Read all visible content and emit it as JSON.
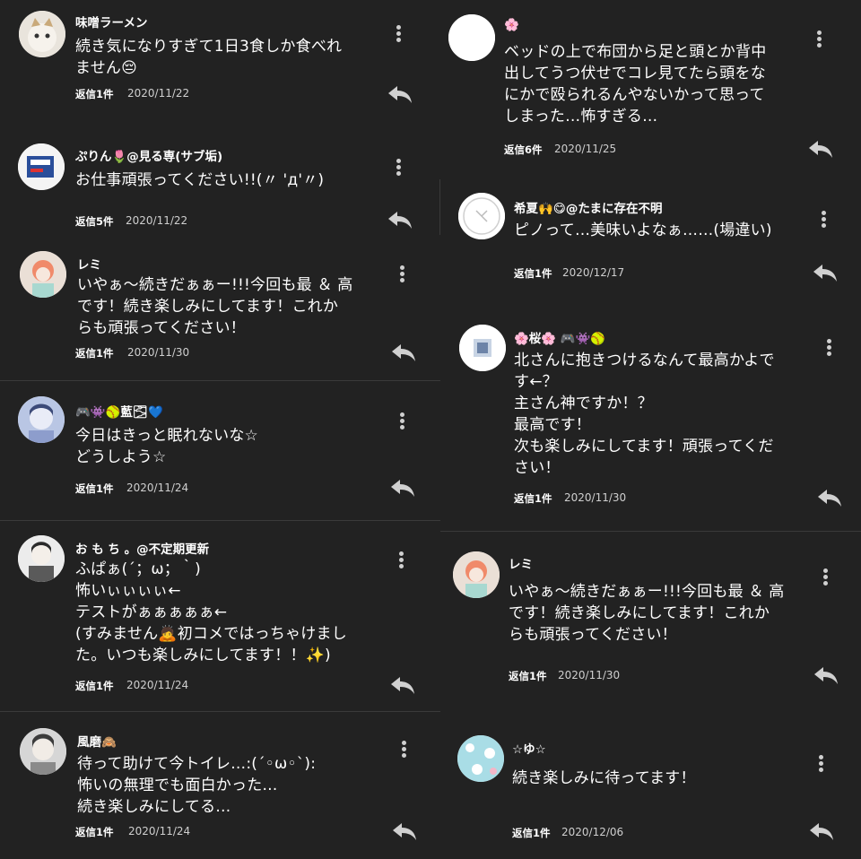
{
  "colors": {
    "background": "#222222",
    "text": "#ffffff",
    "date": "#cfcfcf",
    "icon": "#d0d0d0",
    "divider": "#3a3a3a"
  },
  "icons": {
    "more": "vertical-ellipsis-icon",
    "reply": "reply-arrow-icon"
  },
  "left_comments": [
    {
      "name": "味噌ラーメン",
      "body": "続き気になりすぎて1日3食しか食べれ\nません😔",
      "reply_label": "返信1件",
      "date": "2020/11/22"
    },
    {
      "name": "ぷりん🌷@見る専(サブ垢)",
      "body": "お仕事頑張ってください!!(〃 'д'〃)",
      "reply_label": "返信5件",
      "date": "2020/11/22"
    },
    {
      "name": "レミ",
      "body": "いやぁ〜続きだぁぁー!!!今回も最 ＆ 高\nです！続き楽しみにしてます！これか\nらも頑張ってください！",
      "reply_label": "返信1件",
      "date": "2020/11/30"
    },
    {
      "name": "🎮👾🥎藍🌫💙",
      "body": "今日はきっと眠れないな☆\nどうしよう☆",
      "reply_label": "返信1件",
      "date": "2020/11/24"
    },
    {
      "name": "お も ち 。@不定期更新",
      "body": "ふぱぁ(´；ω；｀)\n怖いぃぃぃぃ←\nテストがぁぁぁぁぁ←\n(すみません🙇初コメではっちゃけまし\nた。いつも楽しみにしてます！！✨)",
      "reply_label": "返信1件",
      "date": "2020/11/24"
    },
    {
      "name": "風磨🙈",
      "body": "待って助けて今トイレ…:(´◦ω◦`):\n怖いの無理でも面白かった…\n続き楽しみにしてる…",
      "reply_label": "返信1件",
      "date": "2020/11/24"
    }
  ],
  "right_comments": [
    {
      "name": "🌸",
      "body": "ベッドの上で布団から足と頭とか背中\n出してうつ伏せでコレ見てたら頭をな\nにかで殴られるんやないかって思って\nしまった…怖すぎる…",
      "reply_label": "返信6件",
      "date": "2020/11/25"
    },
    {
      "name": "希夏🙌😋@たまに存在不明",
      "body": "ピノって…美味いよなぁ……(場違い)",
      "reply_label": "返信1件",
      "date": "2020/12/17"
    },
    {
      "name": "🌸桜🌸 🎮👾🥎",
      "body": "北さんに抱きつけるなんて最高かよで\nす←？\n主さん神ですか！？\n最高です！\n次も楽しみにしてます！頑張ってくだ\nさい！",
      "reply_label": "返信1件",
      "date": "2020/11/30"
    },
    {
      "name": "レミ",
      "body": "いやぁ〜続きだぁぁー!!!今回も最 ＆ 高\nです！続き楽しみにしてます！これか\nらも頑張ってください！",
      "reply_label": "返信1件",
      "date": "2020/11/30"
    },
    {
      "name": "☆ゆ☆",
      "body": "続き楽しみに待ってます！",
      "reply_label": "返信1件",
      "date": "2020/12/06"
    }
  ]
}
